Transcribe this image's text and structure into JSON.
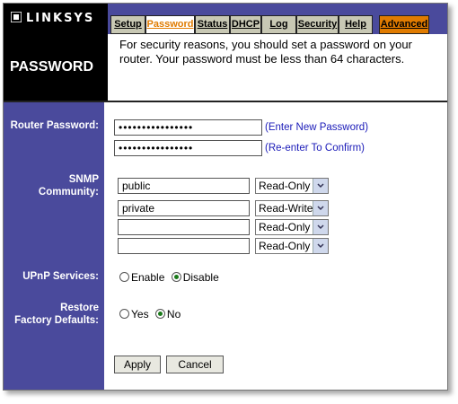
{
  "brand": {
    "name": "LINKSYS"
  },
  "tabs": [
    {
      "label": "Setup"
    },
    {
      "label": "Password"
    },
    {
      "label": "Status"
    },
    {
      "label": "DHCP"
    },
    {
      "label": "Log"
    },
    {
      "label": "Security"
    },
    {
      "label": "Help"
    },
    {
      "label": "Advanced"
    }
  ],
  "page": {
    "title": "PASSWORD",
    "description": "For security reasons, you should set a password on your router. Your password must be less than 64 characters."
  },
  "router_password": {
    "label": "Router Password:",
    "new_value": "••••••••••••••••",
    "confirm_value": "••••••••••••••••",
    "new_hint": "(Enter New Password)",
    "confirm_hint": "(Re-enter To Confirm)"
  },
  "snmp": {
    "label_line1": "SNMP",
    "label_line2": "Community:",
    "rows": [
      {
        "community": "public",
        "access": "Read-Only"
      },
      {
        "community": "private",
        "access": "Read-Write"
      },
      {
        "community": "",
        "access": "Read-Only"
      },
      {
        "community": "",
        "access": "Read-Only"
      }
    ]
  },
  "upnp": {
    "label": "UPnP Services:",
    "enable_label": "Enable",
    "disable_label": "Disable",
    "selected": "Disable"
  },
  "restore": {
    "label_line1": "Restore",
    "label_line2": "Factory Defaults:",
    "yes_label": "Yes",
    "no_label": "No",
    "selected": "No"
  },
  "buttons": {
    "apply": "Apply",
    "cancel": "Cancel"
  },
  "colors": {
    "nav_bg": "#4a4a9c",
    "active_tab": "#e07b00",
    "tab_bg": "#c8c8b4",
    "hint": "#1a1ab8"
  }
}
